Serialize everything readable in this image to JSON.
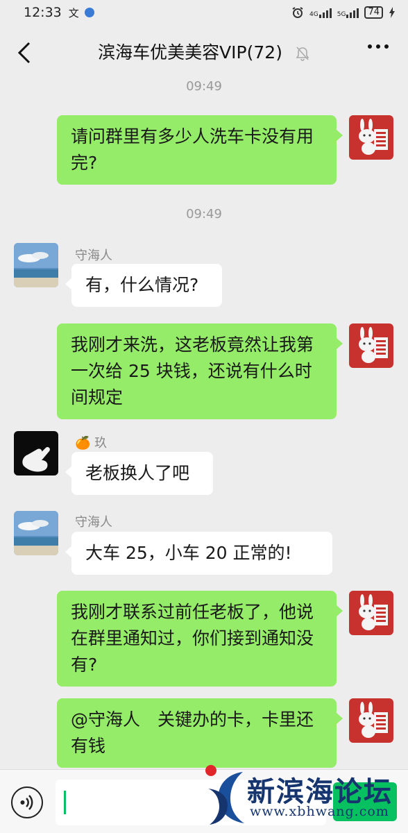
{
  "status_bar": {
    "time": "12:33",
    "network_4g": "4G",
    "network_5g": "5G",
    "battery": "74"
  },
  "chat": {
    "title": "滨海车优美美容VIP(72)"
  },
  "messages": [
    {
      "type": "time",
      "text": "09:49"
    },
    {
      "type": "me",
      "text": "请问群里有多少人洗车卡没有用完?"
    },
    {
      "type": "time",
      "text": "09:49"
    },
    {
      "type": "them",
      "sender": "守海人",
      "text": "有，什么情况?"
    },
    {
      "type": "me",
      "text": "我刚才来洗，这老板竟然让我第一次给 25 块钱，还说有什么时间规定"
    },
    {
      "type": "them",
      "sender": "玖",
      "sender_emoji": "🍊",
      "text": "老板换人了吧"
    },
    {
      "type": "them",
      "sender": "守海人",
      "text": "大车 25，小车 20 正常的!"
    },
    {
      "type": "me",
      "text": "我刚才联系过前任老板了，他说在群里通知过，你们接到通知没有?"
    },
    {
      "type": "me",
      "text": "@守海人　关键办的卡，卡里还有钱"
    }
  ],
  "watermark": {
    "title": "新滨海论坛",
    "url": "www.xbhwang.com"
  },
  "colors": {
    "my_bubble": "#95ec69",
    "their_bubble": "#ffffff",
    "background": "#ededed",
    "accent": "#07c160"
  }
}
